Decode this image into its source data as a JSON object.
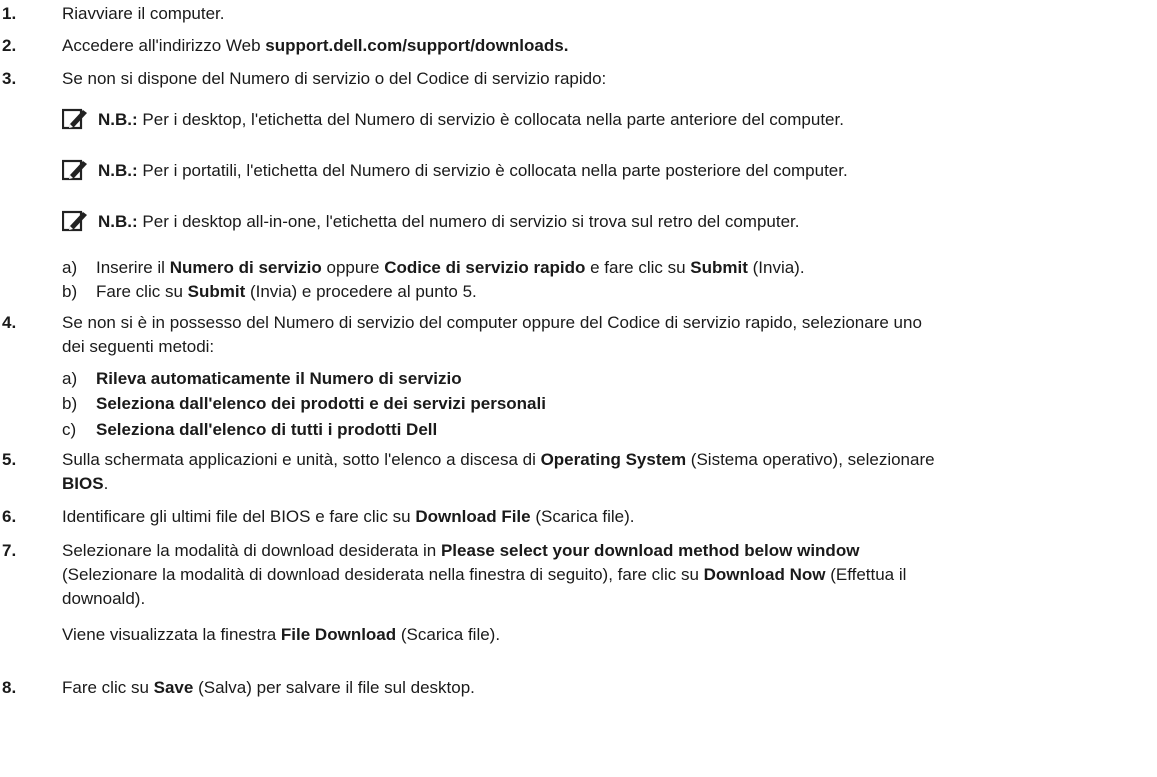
{
  "steps": [
    {
      "num": "1.",
      "parts": [
        {
          "t": "Riavviare il computer."
        }
      ]
    },
    {
      "num": "2.",
      "parts": [
        {
          "t": "Accedere all'indirizzo Web "
        },
        {
          "b": "support.dell.com/support/downloads."
        }
      ]
    },
    {
      "num": "3.",
      "parts": [
        {
          "t": "Se non si dispone del Numero di servizio o del Codice di servizio rapido:"
        }
      ]
    },
    {
      "num": "4.",
      "line1": "Se non si è in possesso del Numero di servizio del computer oppure del Codice di servizio rapido, selezionare uno",
      "line2": "dei seguenti metodi:"
    },
    {
      "num": "5.",
      "line1_parts": [
        {
          "t": "Sulla schermata applicazioni e unità, sotto l'elenco a discesa di "
        },
        {
          "b": "Operating System"
        },
        {
          "t": " (Sistema operativo), selezionare"
        }
      ],
      "line2_parts": [
        {
          "b": "BIOS"
        },
        {
          "t": "."
        }
      ]
    },
    {
      "num": "6.",
      "parts": [
        {
          "t": "Identificare gli ultimi file del BIOS e fare clic su "
        },
        {
          "b": "Download File"
        },
        {
          "t": " (Scarica file)."
        }
      ]
    },
    {
      "num": "7.",
      "line1_parts": [
        {
          "t": "Selezionare la modalità di download desiderata in "
        },
        {
          "b": "Please select your download method below window"
        }
      ],
      "line2_parts": [
        {
          "t": "(Selezionare la modalità di download desiderata nella finestra di seguito), fare clic su "
        },
        {
          "b": "Download Now"
        },
        {
          "t": " (Effettua il"
        }
      ],
      "line3": "downoald).",
      "followup_parts": [
        {
          "t": "Viene visualizzata la finestra "
        },
        {
          "b": "File Download"
        },
        {
          "t": " (Scarica file)."
        }
      ]
    },
    {
      "num": "8.",
      "parts": [
        {
          "t": "Fare clic su "
        },
        {
          "b": "Save"
        },
        {
          "t": " (Salva) per salvare il file sul desktop."
        }
      ]
    }
  ],
  "notes": [
    {
      "label": "N.B.:",
      "text": " Per i desktop, l'etichetta del Numero di servizio è collocata nella parte anteriore del computer."
    },
    {
      "label": "N.B.:",
      "text": " Per i portatili, l'etichetta del Numero di servizio è collocata nella parte posteriore del computer."
    },
    {
      "label": "N.B.:",
      "text": " Per i desktop all-in-one, l'etichetta del numero di servizio si trova sul retro del computer."
    }
  ],
  "substeps3": [
    {
      "letter": "a)",
      "parts": [
        {
          "t": "Inserire il "
        },
        {
          "b": "Numero di servizio"
        },
        {
          "t": " oppure "
        },
        {
          "b": "Codice di servizio rapido"
        },
        {
          "t": " e fare clic su "
        },
        {
          "b": "Submit"
        },
        {
          "t": " (Invia)."
        }
      ]
    },
    {
      "letter": "b)",
      "parts": [
        {
          "t": "Fare clic su "
        },
        {
          "b": "Submit"
        },
        {
          "t": " (Invia) e procedere al punto 5."
        }
      ]
    }
  ],
  "substeps4": [
    {
      "letter": "a)",
      "parts": [
        {
          "b": "Rileva automaticamente il Numero di servizio"
        }
      ]
    },
    {
      "letter": "b)",
      "parts": [
        {
          "b": "Seleziona dall'elenco dei prodotti e dei servizi personali"
        }
      ]
    },
    {
      "letter": "c)",
      "parts": [
        {
          "b": "Seleziona dall'elenco di tutti i prodotti Dell"
        }
      ]
    }
  ]
}
